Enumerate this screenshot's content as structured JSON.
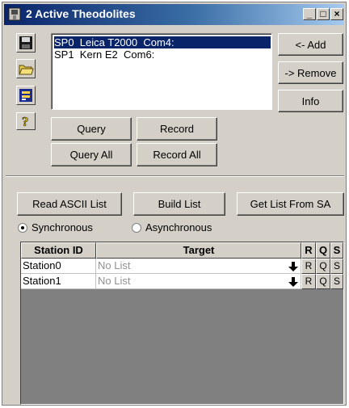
{
  "window": {
    "title": "2 Active Theodolites"
  },
  "titlebar_buttons": {
    "minimize": "_",
    "maximize": "□",
    "close": "×"
  },
  "side_icons": [
    "save-icon",
    "open-folder-icon",
    "database-icon",
    "help-icon"
  ],
  "instruments": [
    {
      "text": "SP0  Leica T2000  Com4:",
      "selected": true
    },
    {
      "text": "SP1  Kern E2  Com6:",
      "selected": false
    }
  ],
  "right_buttons": {
    "add": "<- Add",
    "remove": "-> Remove",
    "info": "Info"
  },
  "actions": {
    "query": "Query",
    "record": "Record",
    "query_all": "Query All",
    "record_all": "Record All"
  },
  "list_buttons": {
    "read_ascii": "Read ASCII List",
    "build": "Build List",
    "get_from_sa": "Get List From SA"
  },
  "mode": {
    "synchronous": "Synchronous",
    "asynchronous": "Asynchronous",
    "selected": "synchronous"
  },
  "table": {
    "headers": {
      "station": "Station ID",
      "target": "Target",
      "r": "R",
      "q": "Q",
      "s": "S"
    },
    "rows": [
      {
        "station": "Station0",
        "target": "No List",
        "r": "R",
        "q": "Q",
        "s": "S"
      },
      {
        "station": "Station1",
        "target": "No List",
        "r": "R",
        "q": "Q",
        "s": "S"
      }
    ]
  }
}
